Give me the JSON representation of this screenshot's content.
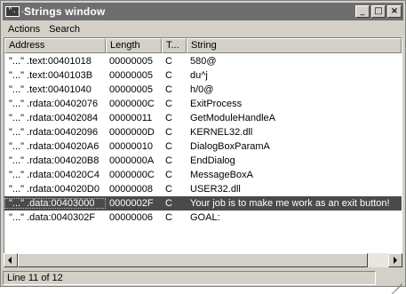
{
  "window": {
    "title": "Strings window",
    "icon_label": "\"...\""
  },
  "title_buttons": {
    "minimize": "_",
    "maximize": "□",
    "close": "×"
  },
  "menu": [
    "Actions",
    "Search"
  ],
  "columns": {
    "address": "Address",
    "length": "Length",
    "type": "T...",
    "string": "String"
  },
  "rows": [
    {
      "address": "\"...\" .text:00401018",
      "length": "00000005",
      "type": "C",
      "string": "580@"
    },
    {
      "address": "\"...\" .text:0040103B",
      "length": "00000005",
      "type": "C",
      "string": "du^j"
    },
    {
      "address": "\"...\" .text:00401040",
      "length": "00000005",
      "type": "C",
      "string": "h/0@"
    },
    {
      "address": "\"...\" .rdata:00402076",
      "length": "0000000C",
      "type": "C",
      "string": "ExitProcess"
    },
    {
      "address": "\"...\" .rdata:00402084",
      "length": "00000011",
      "type": "C",
      "string": "GetModuleHandleA"
    },
    {
      "address": "\"...\" .rdata:00402096",
      "length": "0000000D",
      "type": "C",
      "string": "KERNEL32.dll"
    },
    {
      "address": "\"...\" .rdata:004020A6",
      "length": "00000010",
      "type": "C",
      "string": "DialogBoxParamA"
    },
    {
      "address": "\"...\" .rdata:004020B8",
      "length": "0000000A",
      "type": "C",
      "string": "EndDialog"
    },
    {
      "address": "\"...\" .rdata:004020C4",
      "length": "0000000C",
      "type": "C",
      "string": "MessageBoxA"
    },
    {
      "address": "\"...\" .rdata:004020D0",
      "length": "00000008",
      "type": "C",
      "string": "USER32.dll"
    },
    {
      "address": "\"...\" .data:00403000",
      "length": "0000002F",
      "type": "C",
      "string": "Your job is to make me work as an exit button!"
    },
    {
      "address": "\"...\" .data:0040302F",
      "length": "00000006",
      "type": "C",
      "string": "GOAL:"
    }
  ],
  "selected_row": 10,
  "status": {
    "text": "Line 11 of 12"
  },
  "colors": {
    "titlebar": "#6e6e6e",
    "selection": "#4a4a4a",
    "chrome": "#d4d0c8"
  }
}
